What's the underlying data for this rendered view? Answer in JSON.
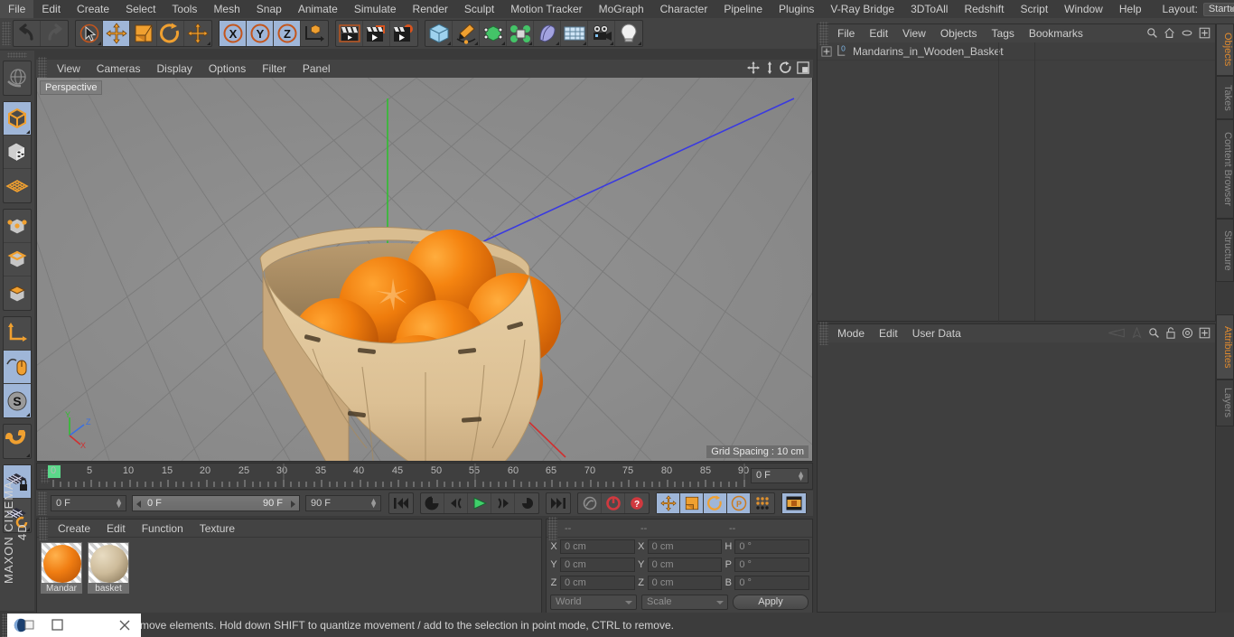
{
  "app": {
    "name": "MAXON CINEMA 4D"
  },
  "menubar": {
    "items": [
      "File",
      "Edit",
      "Create",
      "Select",
      "Tools",
      "Mesh",
      "Snap",
      "Animate",
      "Simulate",
      "Render",
      "Sculpt",
      "Motion Tracker",
      "MoGraph",
      "Character",
      "Pipeline",
      "Plugins",
      "V-Ray Bridge",
      "3DToAll",
      "Redshift",
      "Script",
      "Window",
      "Help"
    ],
    "layout_label": "Layout:",
    "layout_value": "Startup"
  },
  "toolbar": {
    "icons": [
      "undo-icon",
      "redo-icon",
      "live-selection-icon",
      "move-icon",
      "scale-icon",
      "rotate-icon",
      "move-axis-icon",
      "axis-x-icon",
      "axis-y-icon",
      "axis-z-icon",
      "world-object-axis-icon",
      "render-view-icon",
      "render-region-icon",
      "render-settings-icon",
      "cube-icon",
      "spline-pen-icon",
      "nurbs-icon",
      "array-icon",
      "deformer-icon",
      "floor-environment-icon",
      "camera-icon",
      "light-icon"
    ]
  },
  "left_toolbar": {
    "icons": [
      "undo-view-icon",
      "model-mode-icon",
      "texture-mode-icon",
      "polygon-grid-icon",
      "point-mode-icon",
      "edge-mode-icon",
      "polygon-mode-icon",
      "axis-modify-icon",
      "enable-axis-icon",
      "snap-icon",
      "workplane-icon",
      "workplane-lock-icon",
      "workplane-rotate-icon"
    ]
  },
  "viewport": {
    "menu": [
      "View",
      "Cameras",
      "Display",
      "Options",
      "Filter",
      "Panel"
    ],
    "corner_icons": [
      "pan-view-icon",
      "dolly-view-icon",
      "rotate-view-icon",
      "maximize-view-icon"
    ],
    "label": "Perspective",
    "grid_spacing": "Grid Spacing : 10 cm",
    "axis_labels": {
      "x": "X",
      "y": "Y",
      "z": "Z"
    }
  },
  "timeline": {
    "labels": [
      "0",
      "5",
      "10",
      "15",
      "20",
      "25",
      "30",
      "35",
      "40",
      "45",
      "50",
      "55",
      "60",
      "65",
      "70",
      "75",
      "80",
      "85",
      "90"
    ],
    "current_frame": "0 F"
  },
  "transport": {
    "start_frame": "0 F",
    "range_min": "0 F",
    "range_max": "90 F",
    "end_frame": "90 F",
    "buttons": [
      "go-to-start-icon",
      "go-to-previous-key-icon",
      "step-back-icon",
      "play-icon",
      "step-forward-icon",
      "go-to-next-key-icon",
      "go-to-end-icon",
      "record-active-objects-icon",
      "autokeying-icon",
      "keyframe-selection-icon",
      "position-key-icon",
      "scale-key-icon",
      "rotation-key-icon",
      "parameter-key-icon",
      "point-level-animation-icon",
      "timeline-icon"
    ]
  },
  "material_manager": {
    "menu": [
      "Create",
      "Edit",
      "Function",
      "Texture"
    ],
    "materials": [
      {
        "name": "Mandar",
        "color": "#ef7d1a"
      },
      {
        "name": "basket",
        "color": "#cdbb9a"
      }
    ]
  },
  "coordinate_manager": {
    "headers": [
      "--",
      "--",
      "--"
    ],
    "rows": [
      {
        "pos_label": "X",
        "pos_value": "0 cm",
        "size_label": "X",
        "size_value": "0 cm",
        "rot_label": "H",
        "rot_value": "0 °"
      },
      {
        "pos_label": "Y",
        "pos_value": "0 cm",
        "size_label": "Y",
        "size_value": "0 cm",
        "rot_label": "P",
        "rot_value": "0 °"
      },
      {
        "pos_label": "Z",
        "pos_value": "0 cm",
        "size_label": "Z",
        "size_value": "0 cm",
        "rot_label": "B",
        "rot_value": "0 °"
      }
    ],
    "coord_system": "World",
    "transform_mode": "Scale",
    "apply_label": "Apply"
  },
  "object_manager": {
    "menu": [
      "File",
      "Edit",
      "View",
      "Objects",
      "Tags",
      "Bookmarks"
    ],
    "header_icons": [
      "search-icon",
      "home-icon",
      "ellipse-icon",
      "expand-icon"
    ],
    "objects": [
      {
        "name": "Mandarins_in_Wooden_Basket",
        "layer_badge": "0",
        "tag_color": "#22cc22"
      }
    ]
  },
  "attribute_manager": {
    "menu": [
      "Mode",
      "Edit",
      "User Data"
    ],
    "header_icons": [
      "prev-icon",
      "next-icon",
      "search-icon",
      "lock-icon",
      "target-icon",
      "expand-icon"
    ]
  },
  "vertical_tabs": {
    "top": [
      {
        "label": "Objects",
        "active": true
      },
      {
        "label": "Takes",
        "active": false
      },
      {
        "label": "Content Browser",
        "active": false
      },
      {
        "label": "Structure",
        "active": false
      }
    ],
    "bottom": [
      {
        "label": "Attributes",
        "active": true
      },
      {
        "label": "Layers",
        "active": false
      }
    ]
  },
  "statusbar": {
    "message": "move elements. Hold down SHIFT to quantize movement / add to the selection in point mode, CTRL to remove.",
    "window_buttons": [
      "app-icon",
      "minimize-icon",
      "maximize-icon",
      "close-icon"
    ]
  },
  "colors": {
    "accent_orange": "#e08a2e",
    "selection_blue": "#9fb6d8",
    "green_tag": "#22cc22",
    "play_green": "#3fd06a"
  }
}
